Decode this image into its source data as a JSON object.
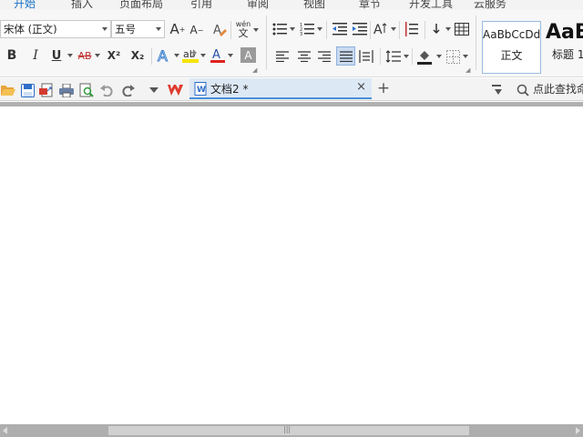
{
  "menu": {
    "tabs": [
      "开始",
      "插入",
      "页面布局",
      "引用",
      "审阅",
      "视图",
      "章节",
      "开发工具",
      "云服务"
    ]
  },
  "font": {
    "family_value": "宋体 (正文)",
    "size_value": "五号"
  },
  "styles": {
    "normal": {
      "preview": "AaBbCcDd",
      "label": "正文"
    },
    "heading1": {
      "preview": "AaB",
      "label": "标题 1"
    }
  },
  "ribbon_glyphs": {
    "grow_font": "A",
    "shrink_font": "A",
    "bold": "B",
    "italic": "I",
    "underline": "U",
    "strikethrough": "AB",
    "superscript": "X²",
    "subscript": "X₂",
    "text_effect": "A",
    "highlight": "ab",
    "font_color": "A",
    "char_shading": "A",
    "pinyin_top": "wén",
    "pinyin_bottom": "文"
  },
  "document_tab": {
    "title": "文档2 *",
    "close": "×"
  },
  "new_tab": "+",
  "find_command": "点此查找命令",
  "scroll_grip": "|||",
  "colors": {
    "accent": "#1a73c8",
    "highlight_yellow": "#f5e400",
    "font_red": "#e02020",
    "wps_logo": "#e03a2f"
  }
}
